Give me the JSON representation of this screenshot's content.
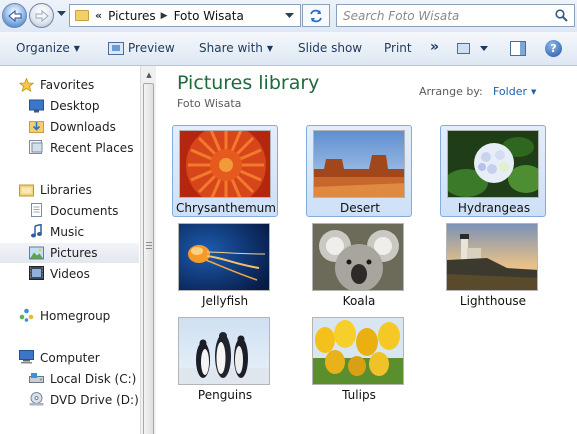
{
  "address_bar": {
    "overflow_chevron": "«",
    "breadcrumbs": [
      "Pictures",
      "Foto Wisata"
    ],
    "search_placeholder": "Search Foto Wisata"
  },
  "toolbar": {
    "organize": "Organize",
    "preview": "Preview",
    "share_with": "Share with",
    "slide_show": "Slide show",
    "print": "Print",
    "more": "»",
    "help": "?"
  },
  "nav_pane": {
    "favorites_header": "Favorites",
    "favorites": [
      "Desktop",
      "Downloads",
      "Recent Places"
    ],
    "libraries_header": "Libraries",
    "libraries": [
      "Documents",
      "Music",
      "Pictures",
      "Videos"
    ],
    "homegroup": "Homegroup",
    "computer_header": "Computer",
    "computer": [
      "Local Disk (C:)",
      "DVD Drive (D:) CD"
    ],
    "selected": "Pictures"
  },
  "library": {
    "title": "Pictures library",
    "subtitle": "Foto Wisata",
    "arrange_by_label": "Arrange by:",
    "arrange_by_value": "Folder"
  },
  "files": [
    {
      "name": "Chrysanthemum",
      "selected": true
    },
    {
      "name": "Desert",
      "selected": true
    },
    {
      "name": "Hydrangeas",
      "selected": true
    },
    {
      "name": "Jellyfish",
      "selected": false
    },
    {
      "name": "Koala",
      "selected": false
    },
    {
      "name": "Lighthouse",
      "selected": false
    },
    {
      "name": "Penguins",
      "selected": false
    },
    {
      "name": "Tulips",
      "selected": false
    }
  ],
  "colors": {
    "library_title": "#1e6a3c",
    "selection_fill": "#cde0f7",
    "selection_border": "#84acdd",
    "link_blue": "#1e5fa8"
  }
}
